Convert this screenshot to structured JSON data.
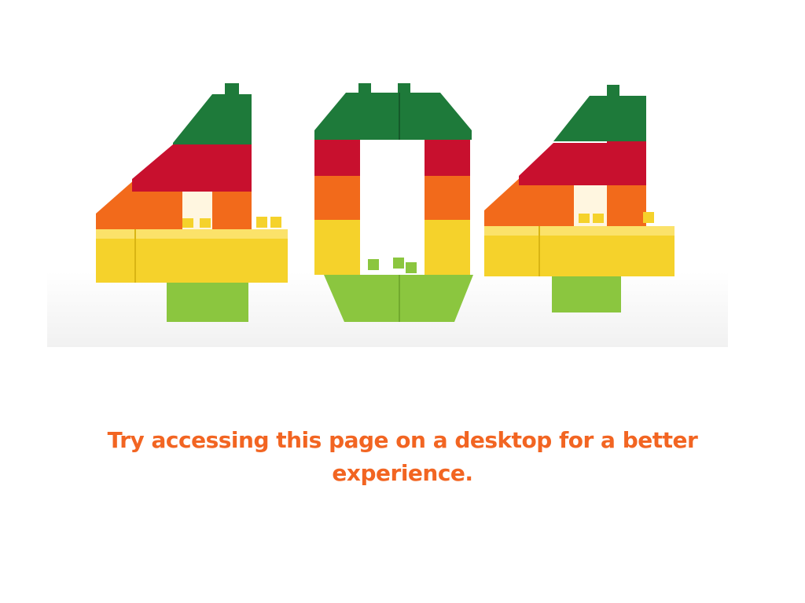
{
  "hero_image": {
    "icon": "lego-404-illustration",
    "colors": {
      "green": "#1e7a3a",
      "red": "#c8102e",
      "orange": "#f26a1b",
      "yellow": "#f5d22b",
      "lime": "#8bc63f"
    }
  },
  "message": {
    "text": "Try accessing this page on a desktop for a better experience.",
    "color": "#f26522"
  }
}
